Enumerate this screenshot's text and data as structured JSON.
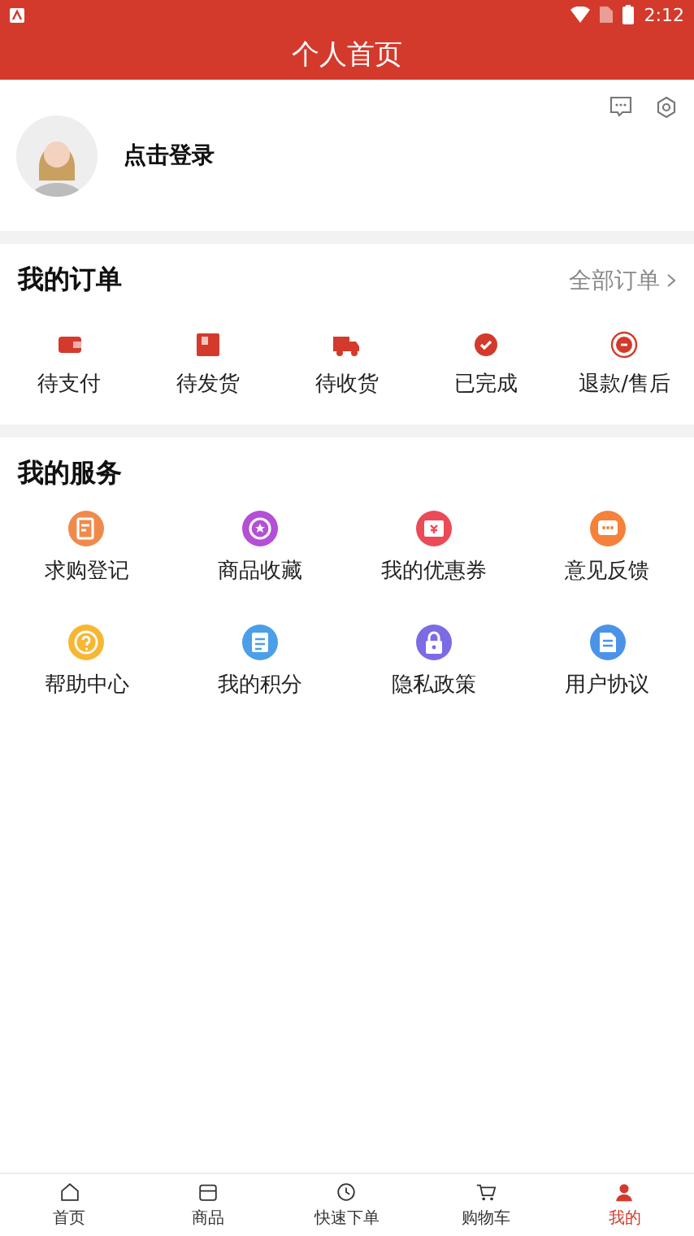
{
  "status_bar": {
    "time": "2:12"
  },
  "header": {
    "title": "个人首页"
  },
  "profile": {
    "login": "点击登录"
  },
  "orders": {
    "title": "我的订单",
    "all_link": "全部订单",
    "items": [
      {
        "label": "待支付"
      },
      {
        "label": "待发货"
      },
      {
        "label": "待收货"
      },
      {
        "label": "已完成"
      },
      {
        "label": "退款/售后"
      }
    ]
  },
  "services": {
    "title": "我的服务",
    "items": [
      {
        "label": "求购登记",
        "color": "#f08a4b"
      },
      {
        "label": "商品收藏",
        "color": "#b44fd6"
      },
      {
        "label": "我的优惠券",
        "color": "#ec4a56"
      },
      {
        "label": "意见反馈",
        "color": "#f5813a"
      },
      {
        "label": "帮助中心",
        "color": "#f7b733"
      },
      {
        "label": "我的积分",
        "color": "#4a9fe8"
      },
      {
        "label": "隐私政策",
        "color": "#7b6be6"
      },
      {
        "label": "用户协议",
        "color": "#4b93e8"
      }
    ]
  },
  "tab_bar": [
    {
      "label": "首页",
      "selected": false
    },
    {
      "label": "商品",
      "selected": false
    },
    {
      "label": "快速下单",
      "selected": false
    },
    {
      "label": "购物车",
      "selected": false
    },
    {
      "label": "我的",
      "selected": true
    }
  ]
}
